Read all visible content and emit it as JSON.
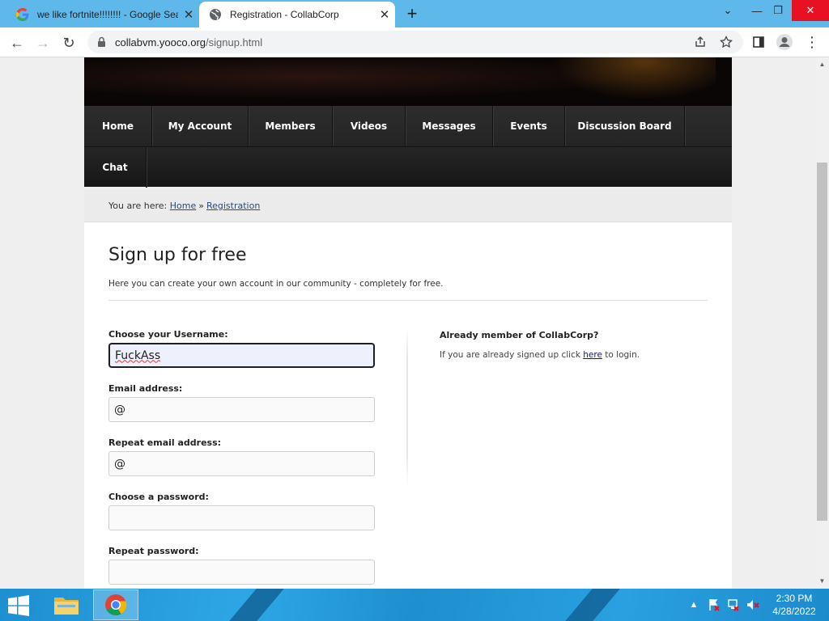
{
  "browser": {
    "tabs": [
      {
        "title": "we like fortnite!!!!!!!! - Google Sea",
        "active": false,
        "favicon": "google-icon"
      },
      {
        "title": "Registration - CollabCorp",
        "active": true,
        "favicon": "globe-icon"
      }
    ],
    "url_host": "collabvm.yooco.org",
    "url_path": "/signup.html"
  },
  "site": {
    "nav_row1": [
      "Home",
      "My Account",
      "Members",
      "Videos",
      "Messages",
      "Events",
      "Discussion Board"
    ],
    "nav_row2": [
      "Chat"
    ],
    "breadcrumb": {
      "prefix": "You are here:",
      "home": "Home",
      "separator": "»",
      "current": "Registration"
    },
    "page_title": "Sign up for free",
    "intro": "Here you can create your own account in our community - completely for free.",
    "form": {
      "username_label": "Choose your Username:",
      "username_value": "FuckAss",
      "email_label": "Email address:",
      "email_value": "@",
      "email_repeat_label": "Repeat email address:",
      "email_repeat_value": "@",
      "password_label": "Choose a password:",
      "password_value": "",
      "password_repeat_label": "Repeat password:",
      "password_repeat_value": ""
    },
    "sidebar": {
      "title": "Already member of CollabCorp?",
      "text_before": "If you are already signed up click ",
      "link": "here",
      "text_after": " to login."
    }
  },
  "taskbar": {
    "time": "2:30 PM",
    "date": "4/28/2022"
  },
  "colors": {
    "tabstrip": "#5fb8ea",
    "menubar": "#222222",
    "taskbar": "#1e8fd0"
  }
}
